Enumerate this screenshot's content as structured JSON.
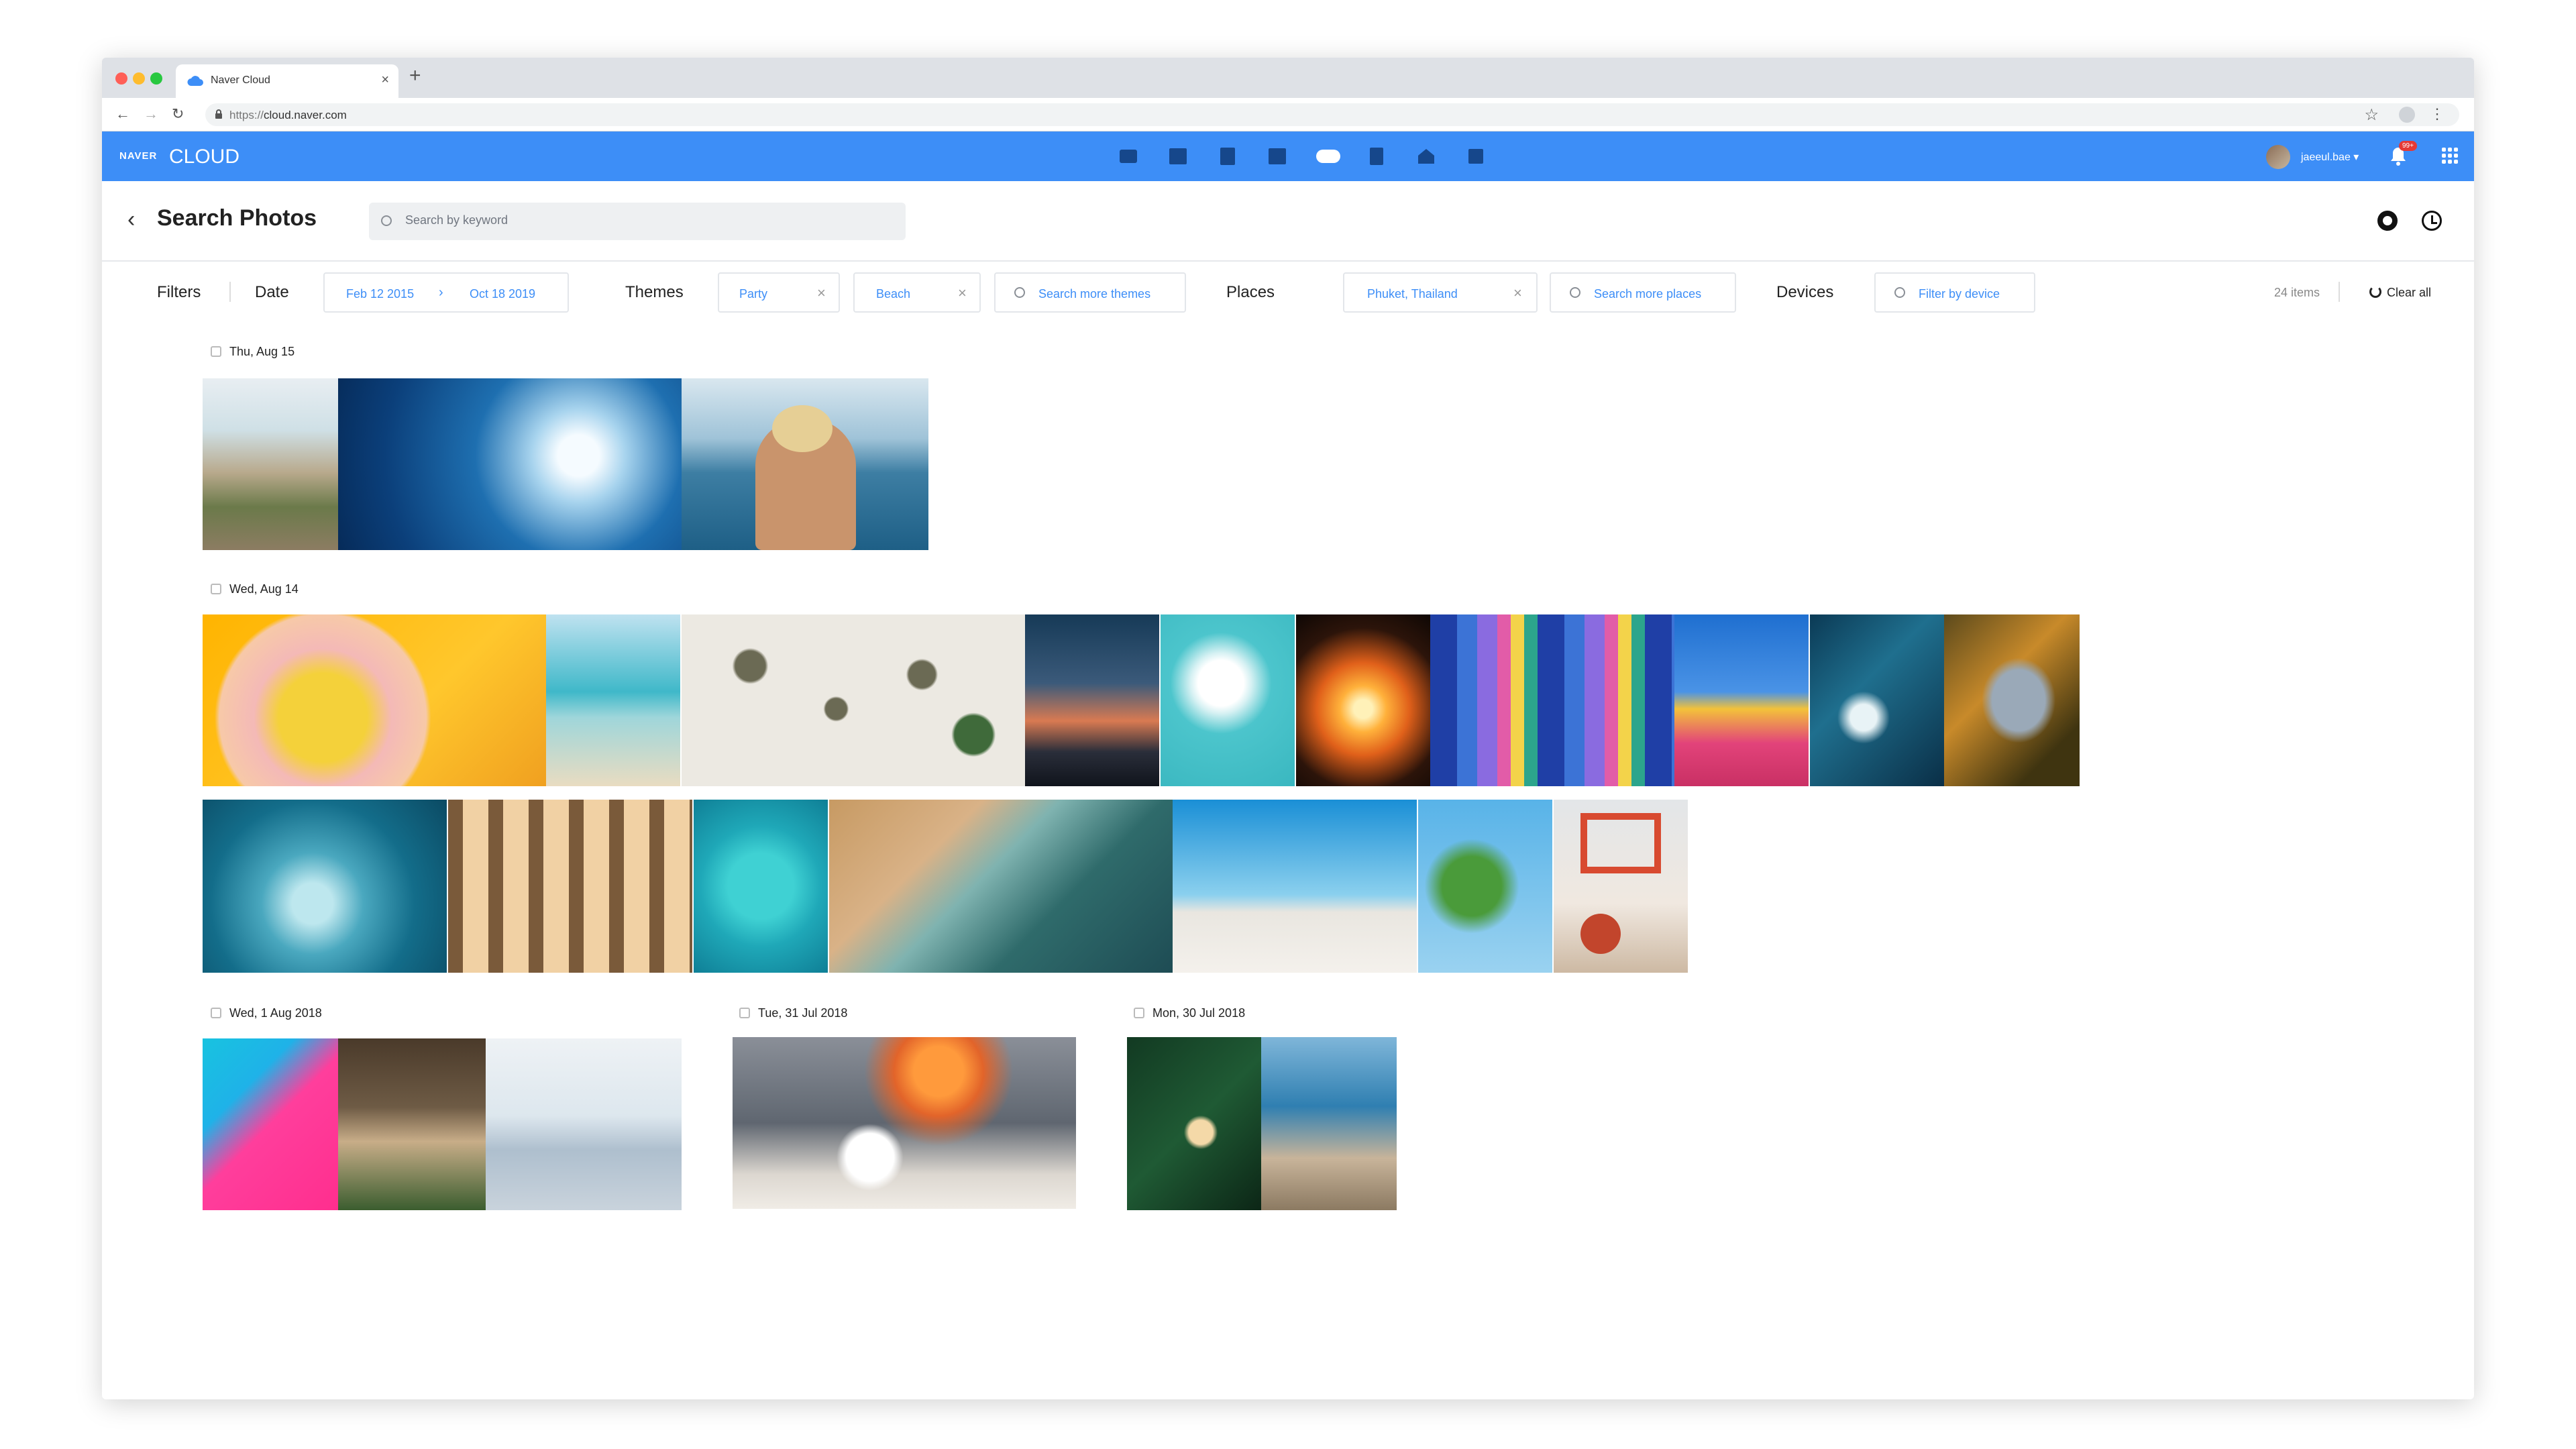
{
  "browser": {
    "tab_title": "Naver Cloud",
    "url_scheme": "https://",
    "url_host": "cloud.naver.com"
  },
  "app": {
    "brand_small": "NAVER",
    "brand_large": "CLOUD",
    "username": "jaeeul.bae ▾",
    "notification_badge": "99+"
  },
  "page": {
    "title": "Search Photos",
    "search_placeholder": "Search by keyword"
  },
  "filters": {
    "label": "Filters",
    "date_label": "Date",
    "date_from": "Feb 12 2015",
    "date_to": "Oct 18 2019",
    "themes_label": "Themes",
    "themes": [
      "Party",
      "Beach"
    ],
    "themes_more": "Search more themes",
    "places_label": "Places",
    "places": [
      "Phuket, Thailand"
    ],
    "places_more": "Search more places",
    "devices_label": "Devices",
    "devices_placeholder": "Filter by device",
    "count": "24 items",
    "clear_all": "Clear all"
  },
  "groups": [
    {
      "date": "Thu, Aug 15",
      "photos": [
        "boardwalk",
        "surfer-wave",
        "woman-sea"
      ]
    },
    {
      "date": "Wed, Aug 14",
      "photos": [
        "donut-float",
        "ice-cream",
        "beach-umbrellas",
        "sunset-silhouette",
        "swan-float",
        "campfire",
        "surfboards",
        "palm-house",
        "ocean-surf",
        "dolphins",
        "barrel-surfer",
        "pier",
        "aerial-swimmers",
        "aerial-coast",
        "beach-jump",
        "palm-leaves",
        "lifeguard-tower"
      ]
    },
    {
      "date": "Wed, 1 Aug 2018",
      "photos": [
        "pink-float",
        "beach-bar"
      ]
    },
    {
      "date": "Tue, 31 Jul 2018",
      "photos": [
        "marshmallows"
      ]
    },
    {
      "date": "Mon, 30 Jul 2018",
      "photos": [
        "ice-cream-cone",
        "sand-hand"
      ]
    }
  ]
}
